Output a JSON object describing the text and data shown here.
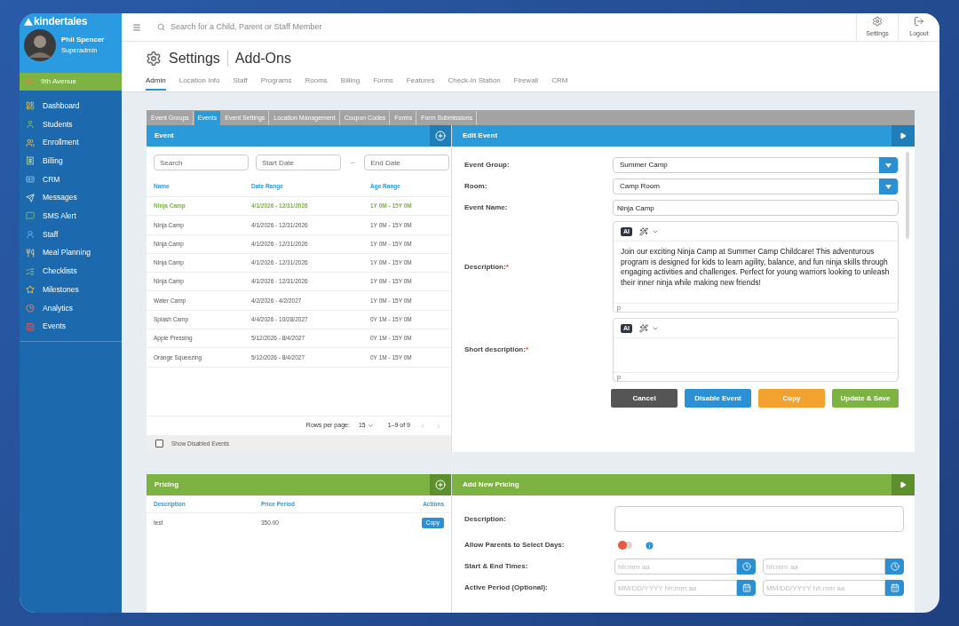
{
  "brand": {
    "name": "kindertales"
  },
  "user": {
    "name": "Phil Spencer",
    "role": "Superadmin"
  },
  "location": "9th Avenue",
  "nav": [
    {
      "label": "Dashboard",
      "kind": "dashboard"
    },
    {
      "label": "Students",
      "kind": "students"
    },
    {
      "label": "Enrollment",
      "kind": "enrollment"
    },
    {
      "label": "Billing",
      "kind": "billing"
    },
    {
      "label": "CRM",
      "kind": "crm"
    },
    {
      "label": "Messages",
      "kind": "messages"
    },
    {
      "label": "SMS Alert",
      "kind": "sms"
    },
    {
      "label": "Staff",
      "kind": "staff"
    },
    {
      "label": "Meal Planning",
      "kind": "meal"
    },
    {
      "label": "Checklists",
      "kind": "checklists"
    },
    {
      "label": "Milestones",
      "kind": "milestones"
    },
    {
      "label": "Analytics",
      "kind": "analytics"
    },
    {
      "label": "Events",
      "kind": "events"
    }
  ],
  "search": {
    "placeholder": "Search for a Child, Parent or Staff Member"
  },
  "top_actions": [
    {
      "label": "Settings",
      "kind": "settings"
    },
    {
      "label": "Logout",
      "kind": "logout"
    }
  ],
  "page": {
    "title": "Settings",
    "subtitle": "Add-Ons"
  },
  "main_tabs": [
    {
      "label": "Admin",
      "selected": true
    },
    {
      "label": "Location Info",
      "selected": false
    },
    {
      "label": "Staff",
      "selected": false
    },
    {
      "label": "Programs",
      "selected": false
    },
    {
      "label": "Rooms",
      "selected": false
    },
    {
      "label": "Billing",
      "selected": false
    },
    {
      "label": "Forms",
      "selected": false
    },
    {
      "label": "Features",
      "selected": false
    },
    {
      "label": "Check-In Station",
      "selected": false
    },
    {
      "label": "Firewall",
      "selected": false
    },
    {
      "label": "CRM",
      "selected": false
    }
  ],
  "sub_tabs": [
    {
      "label": "Event Groups",
      "selected": false
    },
    {
      "label": "Events",
      "selected": true
    },
    {
      "label": "Event Settings",
      "selected": false
    },
    {
      "label": "Location Management",
      "selected": false
    },
    {
      "label": "Coupon Codes",
      "selected": false
    },
    {
      "label": "Forms",
      "selected": false
    },
    {
      "label": "Form Submissions",
      "selected": false
    }
  ],
  "event_list": {
    "title": "Event",
    "filters": [
      {
        "placeholder": "Search"
      },
      {
        "placeholder": "Start Date"
      },
      {
        "placeholder": "End Date"
      }
    ],
    "separator": "–",
    "columns": [
      "Name",
      "Date Range",
      "Age Range"
    ],
    "rows": [
      {
        "name": "Ninja Camp",
        "date_range": "4/1/2026 - 12/31/2026",
        "age_range": "1Y 0M - 15Y 0M",
        "selected": true
      },
      {
        "name": "Ninja Camp",
        "date_range": "4/1/2026 - 12/31/2026",
        "age_range": "1Y 0M - 15Y 0M",
        "selected": false
      },
      {
        "name": "Ninja Camp",
        "date_range": "4/1/2026 - 12/31/2026",
        "age_range": "1Y 0M - 15Y 0M",
        "selected": false
      },
      {
        "name": "Ninja Camp",
        "date_range": "4/1/2026 - 12/31/2026",
        "age_range": "1Y 0M - 15Y 0M",
        "selected": false
      },
      {
        "name": "Ninja Camp",
        "date_range": "4/1/2026 - 12/31/2026",
        "age_range": "1Y 0M - 15Y 0M",
        "selected": false
      },
      {
        "name": "Water Camp",
        "date_range": "4/2/2026 - 4/2/2027",
        "age_range": "1Y 0M - 15Y 0M",
        "selected": false
      },
      {
        "name": "Splash Camp",
        "date_range": "4/4/2026 - 10/28/2027",
        "age_range": "0Y 1M - 15Y 0M",
        "selected": false
      },
      {
        "name": "Apple Pressing",
        "date_range": "5/12/2026 - 8/4/2027",
        "age_range": "0Y 1M - 15Y 0M",
        "selected": false
      },
      {
        "name": "Orange Squeezing",
        "date_range": "5/12/2026 - 8/4/2027",
        "age_range": "0Y 1M - 15Y 0M",
        "selected": false
      }
    ],
    "pagination": {
      "label": "Rows per page:",
      "rows_per_page": "15",
      "range": "1–9 of 9"
    },
    "show_disabled": {
      "label": "Show Disabled Events",
      "checked": false
    }
  },
  "edit_event": {
    "title": "Edit Event",
    "fields": [
      {
        "kind": "select",
        "label": "Event Group:",
        "value": "Summer Camp"
      },
      {
        "kind": "select",
        "label": "Room:",
        "value": "Camp Room"
      },
      {
        "kind": "text",
        "label": "Event Name:",
        "value": "Ninja Camp"
      },
      {
        "kind": "editor",
        "label": "Description:",
        "required_mark": "*",
        "ai_label": "AI",
        "value": "Join our exciting Ninja Camp at Summer Camp Childcare! This adventurous program is designed for kids to learn agility, balance, and fun ninja skills through engaging activities and challenges. Perfect for young warriors looking to unleash their inner ninja while making new friends!",
        "status": "p"
      },
      {
        "kind": "editor",
        "label": "Short description:",
        "required_mark": "*",
        "ai_label": "AI",
        "status": "p"
      }
    ],
    "buttons": [
      {
        "label": "Cancel",
        "kind": "cancel"
      },
      {
        "label": "Disable Event",
        "kind": "disable"
      },
      {
        "label": "Copy",
        "kind": "copy"
      },
      {
        "label": "Update & Save",
        "kind": "save"
      }
    ]
  },
  "pricing": {
    "title": "Pricing",
    "columns": [
      "Description",
      "Price Period",
      "Actions"
    ],
    "rows": [
      {
        "description": "test",
        "price_period": "350.00",
        "action": "Copy"
      }
    ]
  },
  "add_pricing": {
    "title": "Add New Pricing",
    "fields": [
      {
        "kind": "text",
        "label": "Description:"
      },
      {
        "kind": "toggle",
        "label": "Allow Parents to Select Days:",
        "on": false
      },
      {
        "kind": "time_range",
        "label": "Start & End Times:",
        "placeholders": [
          "hh:mm aa",
          "hh:mm aa"
        ]
      },
      {
        "kind": "date_range",
        "label": "Active Period (Optional):",
        "placeholders": [
          "MM/DD/YYYY hh:mm aa",
          "MM/DD/YYYY hh:mm aa"
        ]
      }
    ]
  }
}
